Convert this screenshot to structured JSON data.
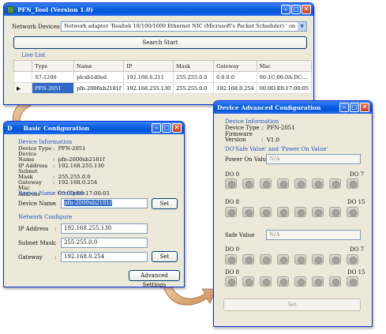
{
  "main_window": {
    "title": "PFN_Tool (Version 1.0)",
    "network_label": "Network Devices :",
    "network_value": "Network adapter 'Realtek 10/100/1000 Ethernet NIC                    (Microsoft's Packet Scheduler) ' on",
    "search_button": "Search Start",
    "live_list_title": "Live List",
    "columns": [
      "",
      "Type",
      "Name",
      "IP",
      "Mask",
      "Gateway",
      "Mac"
    ],
    "rows": [
      [
        "",
        "S7-1200",
        "plcxb1d0ed",
        "192.168.6.211",
        "255.255.0.0",
        "0.0.0.0",
        "00:1C:06:0A:DC:..."
      ],
      [
        "▶",
        "PFN-2051",
        "pfn-2000xb2181f",
        "192.168.255.130",
        "255.255.0.0",
        "192.168.0.254",
        "00:0D:E0:17:00:05"
      ]
    ]
  },
  "basic_window": {
    "title": "Basic Configuration",
    "title_prefix": "D",
    "info_title": "Device Information",
    "info_labels": [
      "Device Type",
      "Device Name",
      "IP Address",
      "Subnet Mask",
      "Gateway",
      "Mac Address"
    ],
    "info_values": [
      "PFN-2051",
      "pfn-2000xb2181f",
      "192.168.255.130",
      "255.255.0.0",
      "192.168.0.254",
      "00:0D:E0:17:00:05"
    ],
    "name_cfg_title": "Device Name Configure",
    "device_name_label": "Device Name",
    "device_name_value": "pfn-2000xb2181f",
    "set_label": "Set",
    "net_cfg_title": "Network Configure",
    "ip_label": "IP Address",
    "ip_value": "192.168.255.130",
    "subnet_label": "Subnet Mask",
    "subnet_value": "255.255.0.0",
    "gateway_label": "Gateway",
    "gateway_value": "192.168.0.254",
    "advanced_button": "Advanced Settings"
  },
  "advanced_window": {
    "title": "Device Advanced Configuration",
    "info_title": "Device Information",
    "device_type_label": "Device Type",
    "device_type_value": "PFN-2051",
    "firmware_label": "Firmware Version",
    "firmware_value": "V1.0",
    "do_title": "DO'Safe Value' and 'Power On Value'",
    "power_on_label": "Power On Value :",
    "power_on_value": "N/A",
    "safe_label": "Safe Value",
    "safe_value": "N/A",
    "do0": "DO 0",
    "do7": "DO 7",
    "do8": "DO 8",
    "do15": "DO 15",
    "set_label": "Set"
  }
}
